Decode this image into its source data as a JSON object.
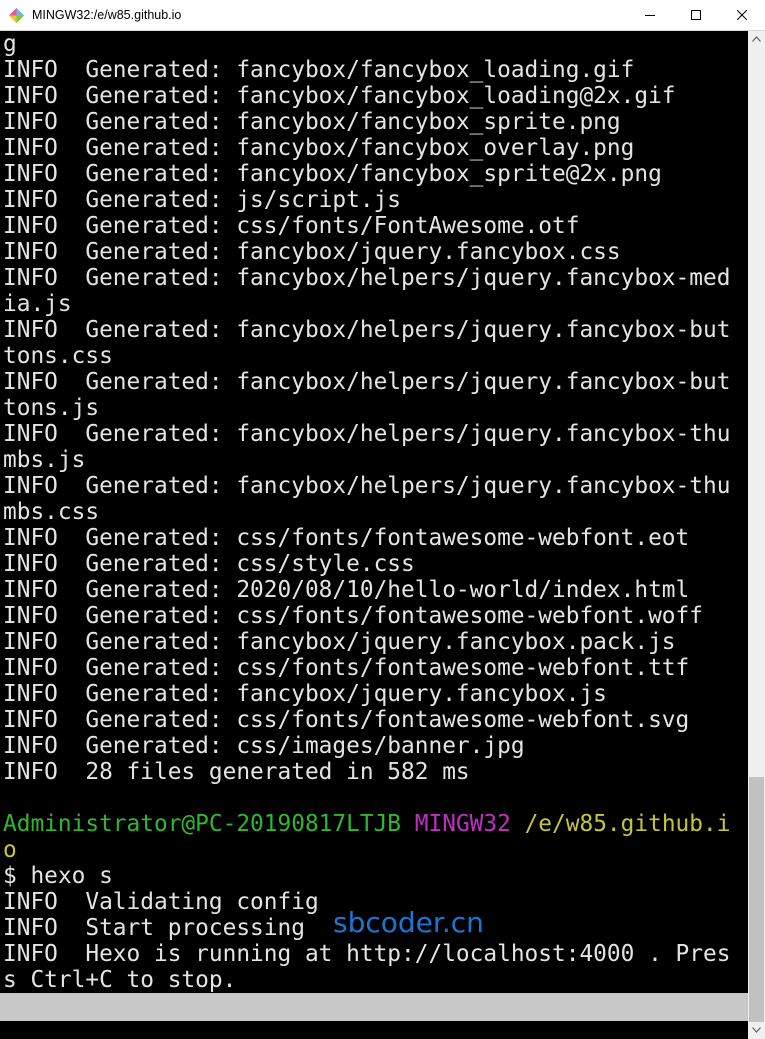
{
  "window": {
    "title": "MINGW32:/e/w85.github.io"
  },
  "terminal": {
    "lines": [
      {
        "segments": [
          {
            "text": "g",
            "color": "default"
          }
        ]
      },
      {
        "segments": [
          {
            "text": "INFO  Generated: fancybox/fancybox_loading.gif",
            "color": "default"
          }
        ]
      },
      {
        "segments": [
          {
            "text": "INFO  Generated: fancybox/fancybox_loading@2x.gif",
            "color": "default"
          }
        ]
      },
      {
        "segments": [
          {
            "text": "INFO  Generated: fancybox/fancybox_sprite.png",
            "color": "default"
          }
        ]
      },
      {
        "segments": [
          {
            "text": "INFO  Generated: fancybox/fancybox_overlay.png",
            "color": "default"
          }
        ]
      },
      {
        "segments": [
          {
            "text": "INFO  Generated: fancybox/fancybox_sprite@2x.png",
            "color": "default"
          }
        ]
      },
      {
        "segments": [
          {
            "text": "INFO  Generated: js/script.js",
            "color": "default"
          }
        ]
      },
      {
        "segments": [
          {
            "text": "INFO  Generated: css/fonts/FontAwesome.otf",
            "color": "default"
          }
        ]
      },
      {
        "segments": [
          {
            "text": "INFO  Generated: fancybox/jquery.fancybox.css",
            "color": "default"
          }
        ]
      },
      {
        "segments": [
          {
            "text": "INFO  Generated: fancybox/helpers/jquery.fancybox-med",
            "color": "default"
          }
        ]
      },
      {
        "segments": [
          {
            "text": "ia.js",
            "color": "default"
          }
        ]
      },
      {
        "segments": [
          {
            "text": "INFO  Generated: fancybox/helpers/jquery.fancybox-but",
            "color": "default"
          }
        ]
      },
      {
        "segments": [
          {
            "text": "tons.css",
            "color": "default"
          }
        ]
      },
      {
        "segments": [
          {
            "text": "INFO  Generated: fancybox/helpers/jquery.fancybox-but",
            "color": "default"
          }
        ]
      },
      {
        "segments": [
          {
            "text": "tons.js",
            "color": "default"
          }
        ]
      },
      {
        "segments": [
          {
            "text": "INFO  Generated: fancybox/helpers/jquery.fancybox-thu",
            "color": "default"
          }
        ]
      },
      {
        "segments": [
          {
            "text": "mbs.js",
            "color": "default"
          }
        ]
      },
      {
        "segments": [
          {
            "text": "INFO  Generated: fancybox/helpers/jquery.fancybox-thu",
            "color": "default"
          }
        ]
      },
      {
        "segments": [
          {
            "text": "mbs.css",
            "color": "default"
          }
        ]
      },
      {
        "segments": [
          {
            "text": "INFO  Generated: css/fonts/fontawesome-webfont.eot",
            "color": "default"
          }
        ]
      },
      {
        "segments": [
          {
            "text": "INFO  Generated: css/style.css",
            "color": "default"
          }
        ]
      },
      {
        "segments": [
          {
            "text": "INFO  Generated: 2020/08/10/hello-world/index.html",
            "color": "default"
          }
        ]
      },
      {
        "segments": [
          {
            "text": "INFO  Generated: css/fonts/fontawesome-webfont.woff",
            "color": "default"
          }
        ]
      },
      {
        "segments": [
          {
            "text": "INFO  Generated: fancybox/jquery.fancybox.pack.js",
            "color": "default"
          }
        ]
      },
      {
        "segments": [
          {
            "text": "INFO  Generated: css/fonts/fontawesome-webfont.ttf",
            "color": "default"
          }
        ]
      },
      {
        "segments": [
          {
            "text": "INFO  Generated: fancybox/jquery.fancybox.js",
            "color": "default"
          }
        ]
      },
      {
        "segments": [
          {
            "text": "INFO  Generated: css/fonts/fontawesome-webfont.svg",
            "color": "default"
          }
        ]
      },
      {
        "segments": [
          {
            "text": "INFO  Generated: css/images/banner.jpg",
            "color": "default"
          }
        ]
      },
      {
        "segments": [
          {
            "text": "INFO  28 files generated in 582 ms",
            "color": "default"
          }
        ]
      },
      {
        "segments": [
          {
            "text": "",
            "color": "default"
          }
        ]
      },
      {
        "segments": [
          {
            "text": "Administrator@PC-20190817LTJB",
            "color": "green"
          },
          {
            "text": " ",
            "color": "default"
          },
          {
            "text": "MINGW32",
            "color": "magenta"
          },
          {
            "text": " ",
            "color": "default"
          },
          {
            "text": "/e/w85.github.i",
            "color": "yellow"
          }
        ]
      },
      {
        "segments": [
          {
            "text": "o",
            "color": "yellow"
          }
        ]
      },
      {
        "segments": [
          {
            "text": "$ hexo s",
            "color": "default"
          }
        ]
      },
      {
        "segments": [
          {
            "text": "INFO  Validating config",
            "color": "default"
          }
        ]
      },
      {
        "segments": [
          {
            "text": "INFO  Start processing",
            "color": "default"
          }
        ]
      },
      {
        "segments": [
          {
            "text": "INFO  Hexo is running at http://localhost:4000 . Pres",
            "color": "default"
          }
        ]
      },
      {
        "segments": [
          {
            "text": "s Ctrl+C to stop.",
            "color": "default"
          }
        ]
      }
    ]
  },
  "watermark": {
    "text": "sbcoder.cn"
  },
  "colors": {
    "default": "#e4e4e4",
    "green": "#2fb82f",
    "magenta": "#c02fc0",
    "yellow": "#c7c43c",
    "background": "#000000",
    "watermark": "#1976d2"
  },
  "icons": {
    "app": "mingw-diamond-icon",
    "minimize": "minimize-icon",
    "maximize": "maximize-icon",
    "close": "close-icon",
    "scroll_up": "arrow-up-icon",
    "scroll_down": "arrow-down-icon"
  },
  "scroll": {
    "position_fraction": 0.75,
    "visible_fraction": 0.25
  }
}
